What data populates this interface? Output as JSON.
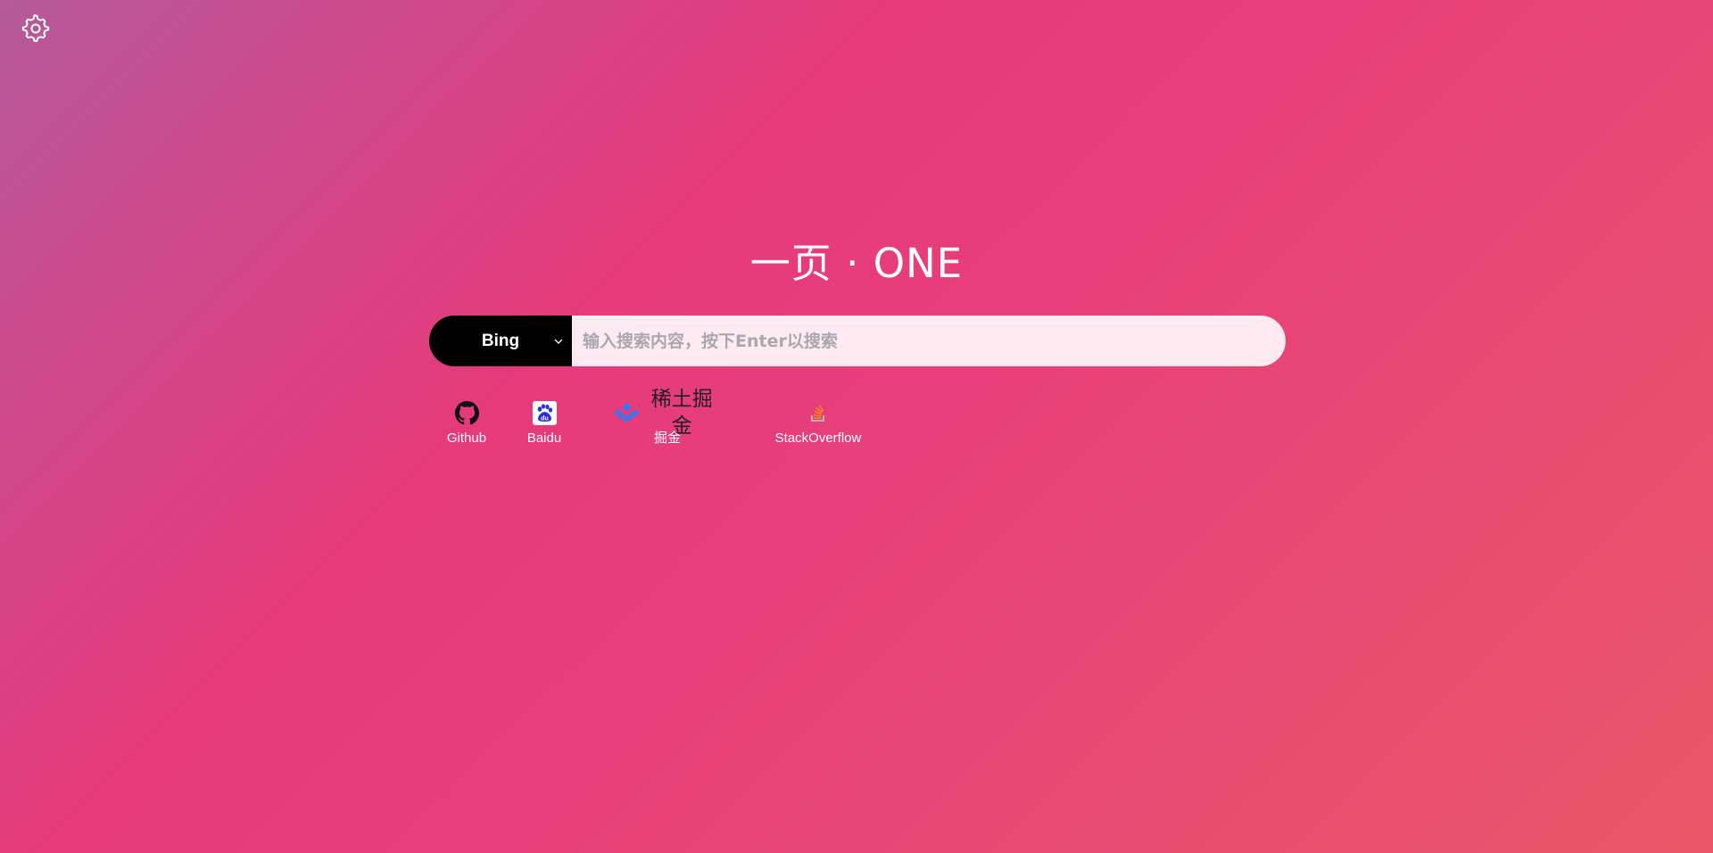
{
  "header": {
    "settings_icon": "gear-icon"
  },
  "title": "一页 · ONE",
  "search": {
    "engine": "Bing",
    "engine_chevron_icon": "chevron-down-icon",
    "placeholder": "输入搜索内容，按下Enter以搜索",
    "value": ""
  },
  "shortcuts": [
    {
      "label": "Github",
      "icon": "github-icon"
    },
    {
      "label": "Baidu",
      "icon": "baidu-icon"
    },
    {
      "label": "掘金",
      "icon": "juejin-logo",
      "logo_text": "稀土掘金"
    },
    {
      "label": "StackOverflow",
      "icon": "stackoverflow-icon"
    }
  ],
  "colors": {
    "background_start": "#b45a9a",
    "background_mid": "#e63a7a",
    "background_end": "#ea5768",
    "engine_bg": "#000000",
    "input_bg": "#fdebf1"
  }
}
